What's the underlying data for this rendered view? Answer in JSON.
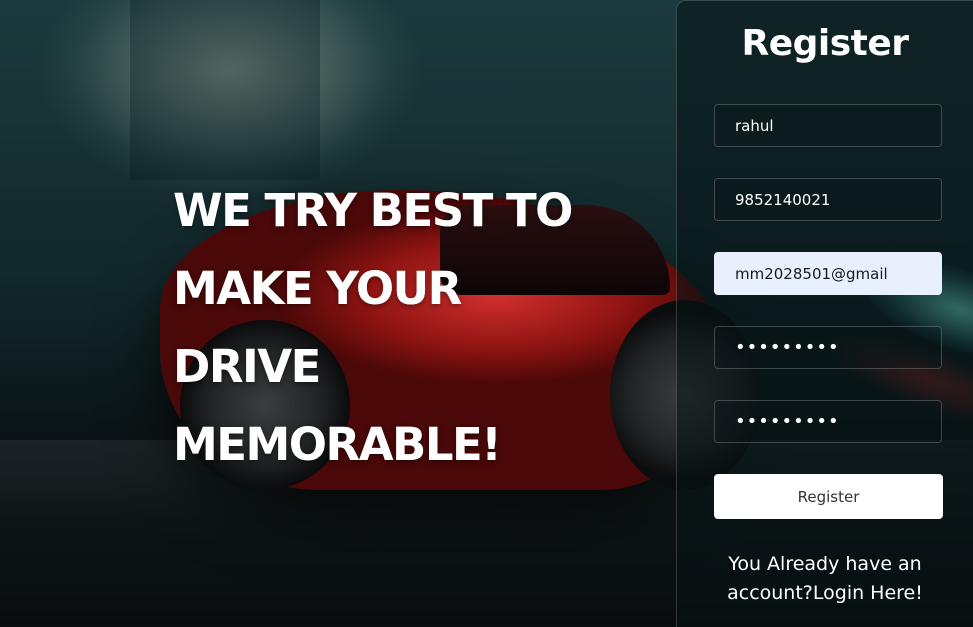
{
  "hero": {
    "lines": [
      "WE TRY BEST TO",
      "MAKE YOUR",
      "DRIVE",
      "MEMORABLE!"
    ]
  },
  "form": {
    "title": "Register",
    "name_value": "rahul",
    "phone_value": "9852140021",
    "email_value": "mm2028501@gmail",
    "password_value": "•••••••••",
    "confirm_password_value": "•••••••••",
    "submit_label": "Register",
    "login_prompt_line1": "You Already have an",
    "login_prompt_line2": "account?Login Here!"
  },
  "colors": {
    "autofill_bg": "#e8f0fe",
    "button_bg": "#ffffff",
    "text": "#ffffff"
  }
}
